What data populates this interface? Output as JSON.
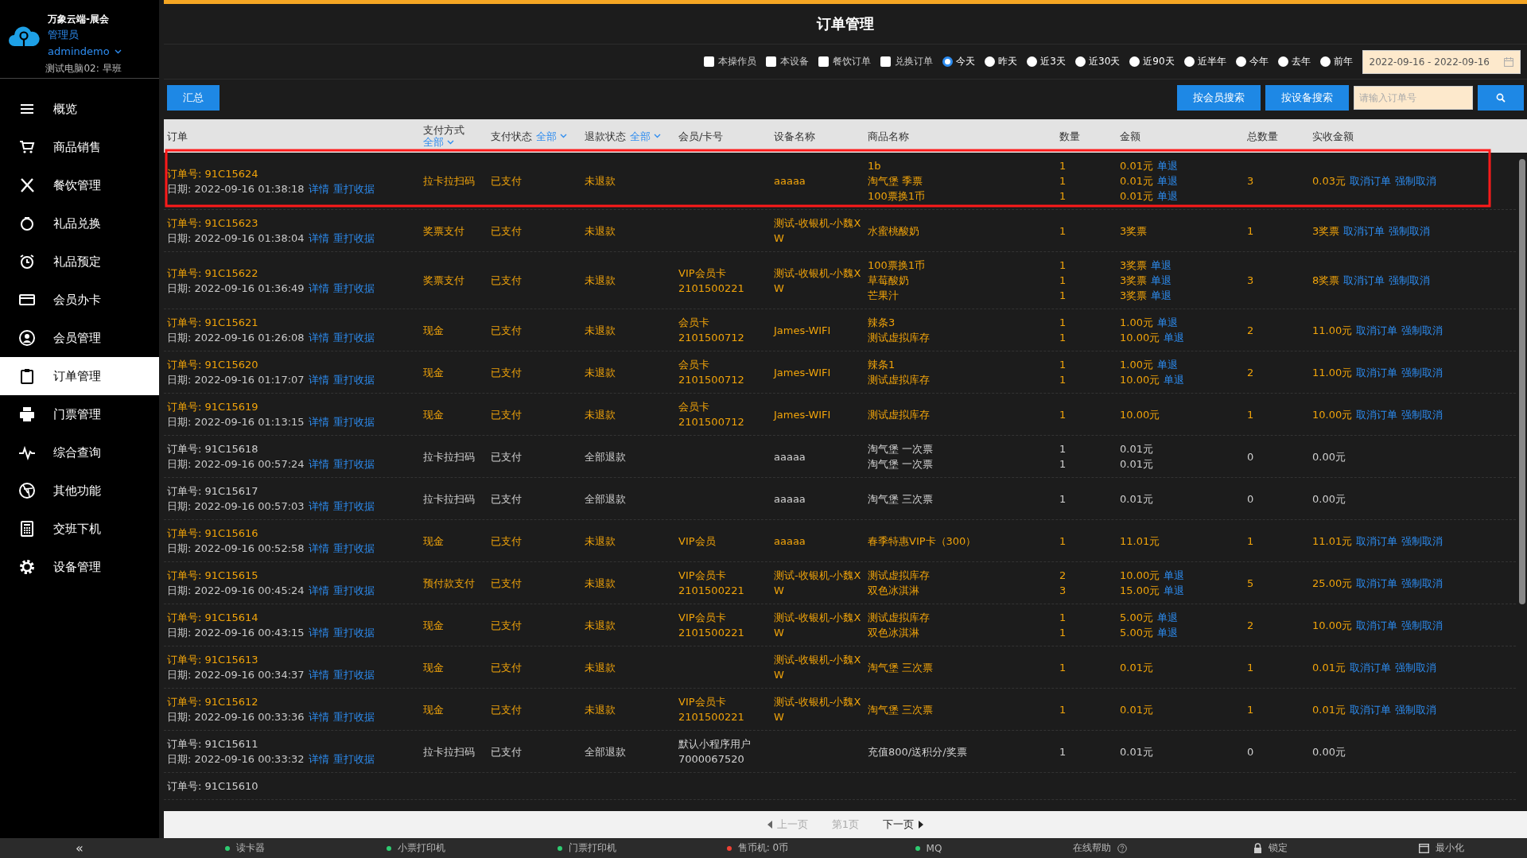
{
  "sidebar": {
    "brand": "万象云端-展会",
    "role": "管理员",
    "user": "admindemo",
    "station": "测试电脑02: 早班",
    "items": [
      {
        "label": "概览",
        "selected": false
      },
      {
        "label": "商品销售",
        "selected": false
      },
      {
        "label": "餐饮管理",
        "selected": false
      },
      {
        "label": "礼品兑换",
        "selected": false
      },
      {
        "label": "礼品预定",
        "selected": false
      },
      {
        "label": "会员办卡",
        "selected": false
      },
      {
        "label": "会员管理",
        "selected": false
      },
      {
        "label": "订单管理",
        "selected": true
      },
      {
        "label": "门票管理",
        "selected": false
      },
      {
        "label": "综合查询",
        "selected": false
      },
      {
        "label": "其他功能",
        "selected": false
      },
      {
        "label": "交班下机",
        "selected": false
      },
      {
        "label": "设备管理",
        "selected": false
      }
    ]
  },
  "page_title": "订单管理",
  "filters": {
    "checkboxes": [
      {
        "label": "本操作员",
        "checked": false
      },
      {
        "label": "本设备",
        "checked": false
      },
      {
        "label": "餐饮订单",
        "checked": false
      },
      {
        "label": "兑换订单",
        "checked": false
      }
    ],
    "ranges": [
      {
        "label": "今天",
        "selected": true
      },
      {
        "label": "昨天",
        "selected": false
      },
      {
        "label": "近3天",
        "selected": false
      },
      {
        "label": "近30天",
        "selected": false
      },
      {
        "label": "近90天",
        "selected": false
      },
      {
        "label": "近半年",
        "selected": false
      },
      {
        "label": "今年",
        "selected": false
      },
      {
        "label": "去年",
        "selected": false
      },
      {
        "label": "前年",
        "selected": false
      }
    ],
    "date_range": "2022-09-16 - 2022-09-16"
  },
  "toolbar": {
    "summary_button": "汇总",
    "search_buttons": [
      "按会员搜索",
      "按设备搜索"
    ],
    "order_search": {
      "placeholder": "请输入订单号"
    }
  },
  "table": {
    "columns": [
      {
        "label": "订单"
      },
      {
        "label": "支付方式",
        "filter": "全部"
      },
      {
        "label": "支付状态",
        "filter": "全部"
      },
      {
        "label": "退款状态",
        "filter": "全部"
      },
      {
        "label": "会员/卡号"
      },
      {
        "label": "设备名称"
      },
      {
        "label": "商品名称"
      },
      {
        "label": "数量"
      },
      {
        "label": "金额"
      },
      {
        "label": "总数量"
      },
      {
        "label": "实收金额"
      }
    ],
    "rows": [
      {
        "kind": "active",
        "order_no": "订单号: 91C15624",
        "date": "日期: 2022-09-16 01:38:18",
        "links": [
          "详情",
          "重打收据"
        ],
        "payment": "拉卡拉扫码",
        "pay_status": "已支付",
        "refund_status": "未退款",
        "device": "aaaaa",
        "items": [
          {
            "name": "1b",
            "qty": "1",
            "amount": "0.01元",
            "refund": "单退"
          },
          {
            "name": "淘气堡 季票",
            "qty": "1",
            "amount": "0.01元",
            "refund": "单退"
          },
          {
            "name": "100票换1币",
            "qty": "1",
            "amount": "0.01元",
            "refund": "单退"
          }
        ],
        "total_qty": "3",
        "received": "0.03元",
        "actions": [
          "取消订单",
          "强制取消"
        ]
      },
      {
        "kind": "active",
        "order_no": "订单号: 91C15623",
        "date": "日期: 2022-09-16 01:38:04",
        "links": [
          "详情",
          "重打收据"
        ],
        "payment": "奖票支付",
        "pay_status": "已支付",
        "refund_status": "未退款",
        "device": "测试-收银机-小魏XW",
        "items": [
          {
            "name": "水蜜桃酸奶",
            "qty": "1",
            "amount": "3奖票"
          }
        ],
        "total_qty": "1",
        "received": "3奖票",
        "actions": [
          "取消订单",
          "强制取消"
        ]
      },
      {
        "kind": "active",
        "order_no": "订单号: 91C15622",
        "date": "日期: 2022-09-16 01:36:49",
        "links": [
          "详情",
          "重打收据"
        ],
        "payment": "奖票支付",
        "pay_status": "已支付",
        "refund_status": "未退款",
        "member": {
          "type": "VIP会员卡",
          "card": "2101500221"
        },
        "device": "测试-收银机-小魏XW",
        "items": [
          {
            "name": "100票换1币",
            "qty": "1",
            "amount": "3奖票",
            "refund": "单退"
          },
          {
            "name": "草莓酸奶",
            "qty": "1",
            "amount": "3奖票",
            "refund": "单退"
          },
          {
            "name": "芒果汁",
            "qty": "1",
            "amount": "3奖票",
            "refund": "单退"
          }
        ],
        "total_qty": "3",
        "received": "8奖票",
        "actions": [
          "取消订单",
          "强制取消"
        ]
      },
      {
        "kind": "active",
        "order_no": "订单号: 91C15621",
        "date": "日期: 2022-09-16 01:26:08",
        "links": [
          "详情",
          "重打收据"
        ],
        "payment": "现金",
        "pay_status": "已支付",
        "refund_status": "未退款",
        "member": {
          "type": "会员卡",
          "card": "2101500712"
        },
        "device": "James-WIFI",
        "items": [
          {
            "name": "辣条3",
            "qty": "1",
            "amount": "1.00元",
            "refund": "单退"
          },
          {
            "name": "测试虚拟库存",
            "qty": "1",
            "amount": "10.00元",
            "refund": "单退"
          }
        ],
        "total_qty": "2",
        "received": "11.00元",
        "actions": [
          "取消订单",
          "强制取消"
        ]
      },
      {
        "kind": "active",
        "order_no": "订单号: 91C15620",
        "date": "日期: 2022-09-16 01:17:07",
        "links": [
          "详情",
          "重打收据"
        ],
        "payment": "现金",
        "pay_status": "已支付",
        "refund_status": "未退款",
        "member": {
          "type": "会员卡",
          "card": "2101500712"
        },
        "device": "James-WIFI",
        "items": [
          {
            "name": "辣条1",
            "qty": "1",
            "amount": "1.00元",
            "refund": "单退"
          },
          {
            "name": "测试虚拟库存",
            "qty": "1",
            "amount": "10.00元",
            "refund": "单退"
          }
        ],
        "total_qty": "2",
        "received": "11.00元",
        "actions": [
          "取消订单",
          "强制取消"
        ]
      },
      {
        "kind": "active",
        "order_no": "订单号: 91C15619",
        "date": "日期: 2022-09-16 01:13:15",
        "links": [
          "详情",
          "重打收据"
        ],
        "payment": "现金",
        "pay_status": "已支付",
        "refund_status": "未退款",
        "member": {
          "type": "会员卡",
          "card": "2101500712"
        },
        "device": "James-WIFI",
        "items": [
          {
            "name": "测试虚拟库存",
            "qty": "1",
            "amount": "10.00元"
          }
        ],
        "total_qty": "1",
        "received": "10.00元",
        "actions": [
          "取消订单",
          "强制取消"
        ]
      },
      {
        "kind": "refunded",
        "order_no": "订单号: 91C15618",
        "date": "日期: 2022-09-16 00:57:24",
        "links": [
          "详情",
          "重打收据"
        ],
        "payment": "拉卡拉扫码",
        "pay_status": "已支付",
        "refund_status": "全部退款",
        "device": "aaaaa",
        "items": [
          {
            "name": "淘气堡 一次票",
            "qty": "1",
            "amount": "0.01元"
          },
          {
            "name": "淘气堡 一次票",
            "qty": "1",
            "amount": "0.01元"
          }
        ],
        "total_qty": "0",
        "received": "0.00元"
      },
      {
        "kind": "refunded",
        "order_no": "订单号: 91C15617",
        "date": "日期: 2022-09-16 00:57:03",
        "links": [
          "详情",
          "重打收据"
        ],
        "payment": "拉卡拉扫码",
        "pay_status": "已支付",
        "refund_status": "全部退款",
        "device": "aaaaa",
        "items": [
          {
            "name": "淘气堡 三次票",
            "qty": "1",
            "amount": "0.01元"
          }
        ],
        "total_qty": "0",
        "received": "0.00元"
      },
      {
        "kind": "active",
        "order_no": "订单号: 91C15616",
        "date": "日期: 2022-09-16 00:52:58",
        "links": [
          "详情",
          "重打收据"
        ],
        "payment": "现金",
        "pay_status": "已支付",
        "refund_status": "未退款",
        "member": {
          "type": "VIP会员"
        },
        "device": "aaaaa",
        "items": [
          {
            "name": "春季特惠VIP卡（300）",
            "qty": "1",
            "amount": "11.01元"
          }
        ],
        "total_qty": "1",
        "received": "11.01元",
        "actions": [
          "取消订单",
          "强制取消"
        ]
      },
      {
        "kind": "active",
        "order_no": "订单号: 91C15615",
        "date": "日期: 2022-09-16 00:45:24",
        "links": [
          "详情",
          "重打收据"
        ],
        "payment": "预付款支付",
        "pay_status": "已支付",
        "refund_status": "未退款",
        "member": {
          "type": "VIP会员卡",
          "card": "2101500221"
        },
        "device": "测试-收银机-小魏XW",
        "items": [
          {
            "name": "测试虚拟库存",
            "qty": "2",
            "amount": "10.00元",
            "refund": "单退"
          },
          {
            "name": "双色冰淇淋",
            "qty": "3",
            "amount": "15.00元",
            "refund": "单退"
          }
        ],
        "total_qty": "5",
        "received": "25.00元",
        "actions": [
          "取消订单",
          "强制取消"
        ]
      },
      {
        "kind": "active",
        "order_no": "订单号: 91C15614",
        "date": "日期: 2022-09-16 00:43:15",
        "links": [
          "详情",
          "重打收据"
        ],
        "payment": "现金",
        "pay_status": "已支付",
        "refund_status": "未退款",
        "member": {
          "type": "VIP会员卡",
          "card": "2101500221"
        },
        "device": "测试-收银机-小魏XW",
        "items": [
          {
            "name": "测试虚拟库存",
            "qty": "1",
            "amount": "5.00元",
            "refund": "单退"
          },
          {
            "name": "双色冰淇淋",
            "qty": "1",
            "amount": "5.00元",
            "refund": "单退"
          }
        ],
        "total_qty": "2",
        "received": "10.00元",
        "actions": [
          "取消订单",
          "强制取消"
        ]
      },
      {
        "kind": "active",
        "order_no": "订单号: 91C15613",
        "date": "日期: 2022-09-16 00:34:37",
        "links": [
          "详情",
          "重打收据"
        ],
        "payment": "现金",
        "pay_status": "已支付",
        "refund_status": "未退款",
        "device": "测试-收银机-小魏XW",
        "items": [
          {
            "name": "淘气堡 三次票",
            "qty": "1",
            "amount": "0.01元"
          }
        ],
        "total_qty": "1",
        "received": "0.01元",
        "actions": [
          "取消订单",
          "强制取消"
        ]
      },
      {
        "kind": "active",
        "order_no": "订单号: 91C15612",
        "date": "日期: 2022-09-16 00:33:36",
        "links": [
          "详情",
          "重打收据"
        ],
        "payment": "现金",
        "pay_status": "已支付",
        "refund_status": "未退款",
        "member": {
          "type": "VIP会员卡",
          "card": "2101500221"
        },
        "device": "测试-收银机-小魏XW",
        "items": [
          {
            "name": "淘气堡 三次票",
            "qty": "1",
            "amount": "0.01元"
          }
        ],
        "total_qty": "1",
        "received": "0.01元",
        "actions": [
          "取消订单",
          "强制取消"
        ]
      },
      {
        "kind": "refunded",
        "order_no": "订单号: 91C15611",
        "date": "日期: 2022-09-16 00:33:32",
        "links": [
          "详情",
          "重打收据"
        ],
        "payment": "拉卡拉扫码",
        "pay_status": "已支付",
        "refund_status": "全部退款",
        "member": {
          "type": "默认小程序用户",
          "card": "7000067520"
        },
        "items": [
          {
            "name": "充值800/送积分/奖票",
            "qty": "1",
            "amount": "0.01元"
          }
        ],
        "total_qty": "0",
        "received": "0.00元"
      },
      {
        "kind": "refunded",
        "order_no": "订单号: 91C15610"
      }
    ]
  },
  "pagination": [
    {
      "kind": "prev",
      "label": "上一页",
      "disabled": true
    },
    {
      "kind": "page",
      "label": "第1页",
      "disabled": true
    },
    {
      "kind": "next",
      "label": "下一页",
      "disabled": false
    }
  ],
  "status_bar": {
    "collapse": "«",
    "items": [
      {
        "kind": "device",
        "label": "读卡器",
        "color": "#2ecc71"
      },
      {
        "kind": "device",
        "label": "小票打印机",
        "color": "#2ecc71"
      },
      {
        "kind": "device",
        "label": "门票打印机",
        "color": "#2ecc71"
      },
      {
        "kind": "device",
        "label": "售币机: 0币",
        "color": "#f04134"
      },
      {
        "kind": "device",
        "label": "MQ",
        "color": "#2ecc71"
      },
      {
        "kind": "help",
        "label": "在线帮助"
      },
      {
        "kind": "lock",
        "label": "锁定"
      },
      {
        "kind": "minimize",
        "label": "最小化"
      }
    ]
  }
}
